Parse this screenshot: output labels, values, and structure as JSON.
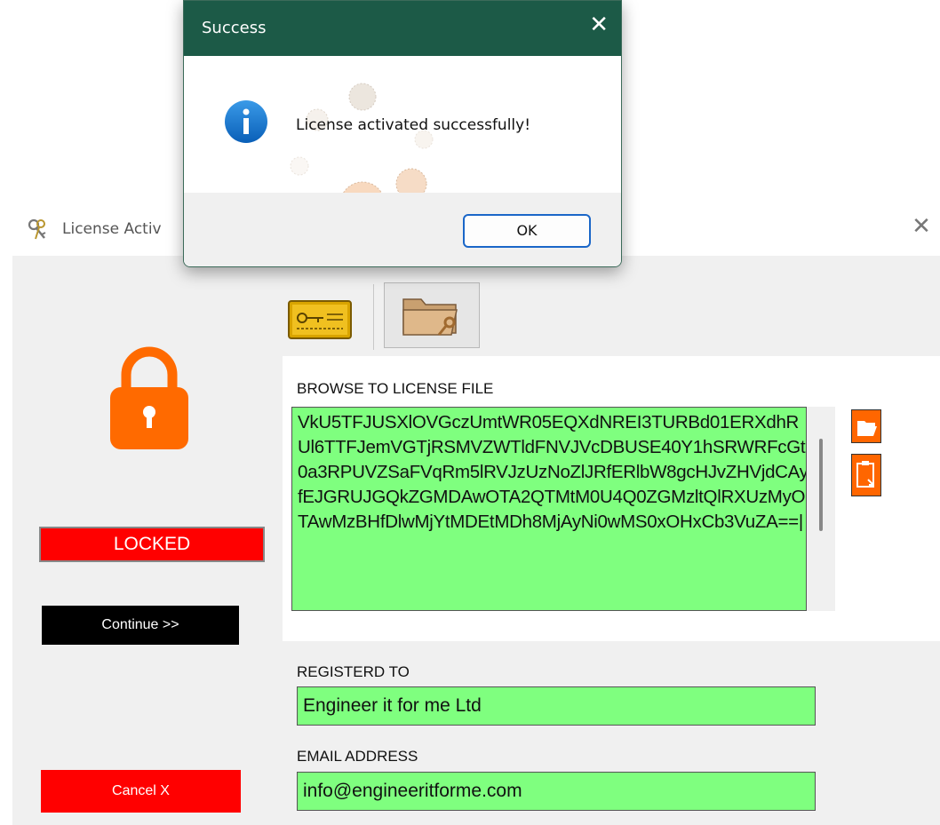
{
  "main_window": {
    "title": "License Activ",
    "close_glyph": "✕"
  },
  "status": {
    "label": "LOCKED",
    "color": "#ff0000"
  },
  "buttons": {
    "continue": "Continue >>",
    "cancel": "Cancel X"
  },
  "tabs": [
    {
      "icon": "license-key-card-icon",
      "selected": false
    },
    {
      "icon": "folder-key-icon",
      "selected": true
    }
  ],
  "license_file": {
    "label": "BROWSE TO LICENSE FILE",
    "content": "VkU5TFJUSXlOVGczUmtWR05EQXdNREI3TURBd01ERXdhRUl6TTFJemVGTjRSMVZWTldFNVJVcDBUSE40Y1hSRWRFcGt0a3RPUVZSaFVqRm5lRVJzUzNoZlJRfERlbW8gcHJvZHVjdCAyfEJGRUJGQkZGMDAwOTA2QTMtM0U4Q0ZGMzltQlRXUzMyOTAwMzBHfDlwMjYtMDEtMDh8MjAyNi0wMS0xOHxCb3VuZA==|",
    "accent": "#7fff7f"
  },
  "side_buttons": [
    "open-folder-icon",
    "clipboard-paste-icon"
  ],
  "registered_to": {
    "label": "REGISTERD TO",
    "value": "Engineer it for me Ltd"
  },
  "email": {
    "label": "EMAIL ADDRESS",
    "value": "info@engineeritforme.com"
  },
  "dialog": {
    "title": "Success",
    "close_glyph": "✕",
    "message": "License activated successfully!",
    "ok": "OK",
    "icon": "info-icon",
    "titlebar_color": "#1c5a47"
  }
}
